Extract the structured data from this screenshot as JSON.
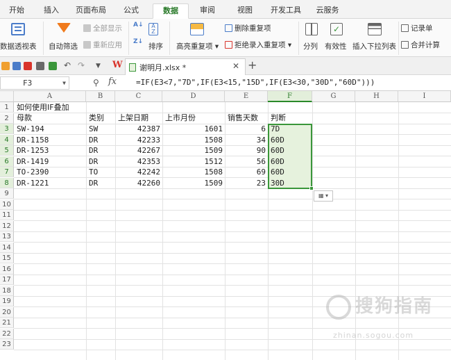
{
  "ribbon_tabs": [
    "开始",
    "插入",
    "页面布局",
    "公式",
    "数据",
    "审阅",
    "视图",
    "开发工具",
    "云服务"
  ],
  "active_tab": "数据",
  "toolbar": {
    "pivot": "数据透视表",
    "autofilter": "自动筛选",
    "show_all": "全部显示",
    "reapply": "重新应用",
    "sort": "排序",
    "highlight_dup": "高亮重复项",
    "remove_dup": "删除重复项",
    "reject_dup": "拒绝录入重复项",
    "split": "分列",
    "validity": "有效性",
    "insert_dropdown": "插入下拉列表",
    "record_form": "记录单",
    "merge_calc": "合并计算"
  },
  "file_tab": {
    "name": "谢明月.xlsx *"
  },
  "formula_bar": {
    "name_box": "F3",
    "fx": "fx",
    "formula": "=IF(E3<7,\"7D\",IF(E3<15,\"15D\",IF(E3<30,\"30D\",\"60D\")))"
  },
  "sheet": {
    "columns": [
      "A",
      "B",
      "C",
      "D",
      "E",
      "F",
      "G",
      "H",
      "I"
    ],
    "rows": [
      "1",
      "2",
      "3",
      "4",
      "5",
      "6",
      "7",
      "8",
      "9",
      "10",
      "11",
      "12",
      "13",
      "14",
      "15",
      "16",
      "17",
      "18",
      "19",
      "20",
      "21",
      "22",
      "23"
    ],
    "title": "如何使用IF叠加",
    "headers": [
      "母款",
      "类别",
      "上架日期",
      "上市月份",
      "销售天数",
      "判断"
    ],
    "data": [
      [
        "SW-194",
        "SW",
        "42387",
        "1601",
        "6",
        "7D"
      ],
      [
        "DR-1158",
        "DR",
        "42233",
        "1508",
        "34",
        "60D"
      ],
      [
        "DR-1253",
        "DR",
        "42267",
        "1509",
        "90",
        "60D"
      ],
      [
        "DR-1419",
        "DR",
        "42353",
        "1512",
        "56",
        "60D"
      ],
      [
        "TO-2390",
        "TO",
        "42242",
        "1508",
        "69",
        "60D"
      ],
      [
        "DR-1221",
        "DR",
        "42260",
        "1509",
        "23",
        "30D"
      ]
    ]
  },
  "watermark": {
    "text": "搜狗指南",
    "url": "zhinan.sogou.com"
  }
}
